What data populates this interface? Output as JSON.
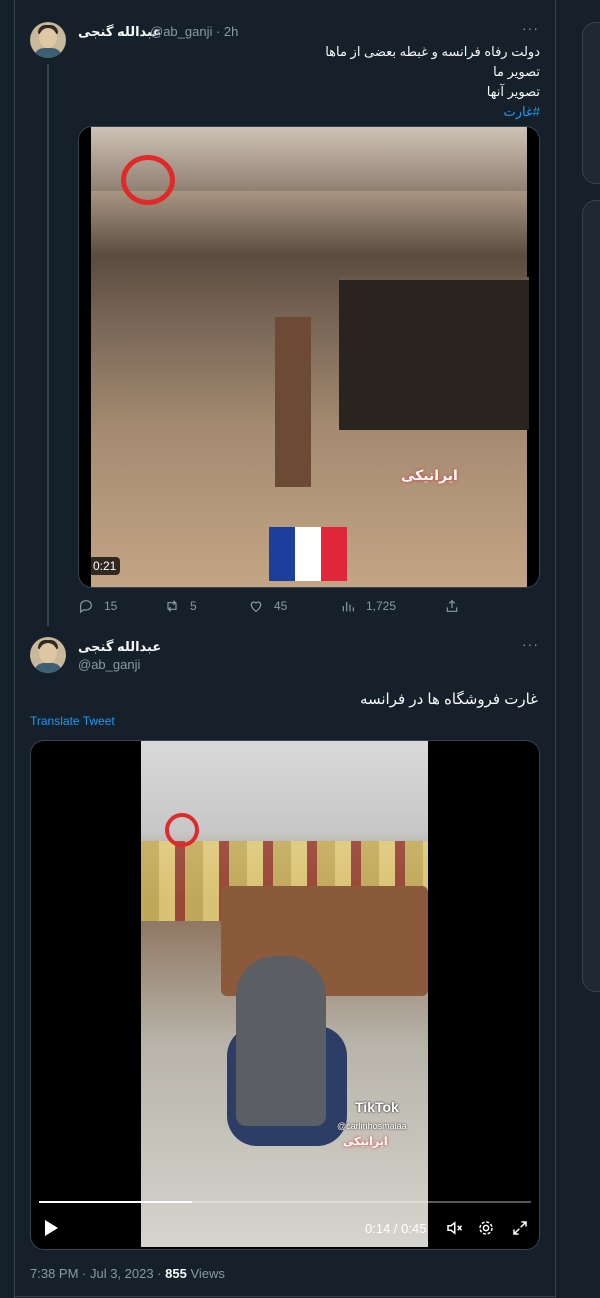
{
  "colors": {
    "background": "#15202b",
    "link": "#1d9bf0",
    "muted": "#8b98a5",
    "text": "#f7f9f9"
  },
  "quoted_tweet": {
    "author_name": "عبدالله گنجی",
    "author_handle_time": "@ab_ganji · 2h",
    "text_lines": [
      "دولت رفاه فرانسه و غبطه بعضی از ماها",
      "تصویر ما",
      "تصویر آنها"
    ],
    "hashtag": "#غارت",
    "video": {
      "duration": "0:21",
      "watermark": "ایرانیکی",
      "icon": "france-flag-emoji"
    },
    "actions": {
      "replies": "15",
      "retweets": "5",
      "likes": "45",
      "views": "1,725"
    }
  },
  "main_tweet": {
    "author_name": "عبدالله گنجی",
    "author_handle": "@ab_ganji",
    "text": "غارت فروشگاه ها در فرانسه",
    "translate_label": "Translate Tweet",
    "video": {
      "tiktok_label": "TikTok",
      "tiktok_user": "@carlinhosmaiaa",
      "watermark": "ایرانیکی",
      "current_time": "0:14",
      "total_time": "0:45",
      "progress_fraction": 0.31
    },
    "timestamp": "7:38 PM · Jul 3, 2023 ·",
    "views_count": "855",
    "views_label": "Views"
  }
}
